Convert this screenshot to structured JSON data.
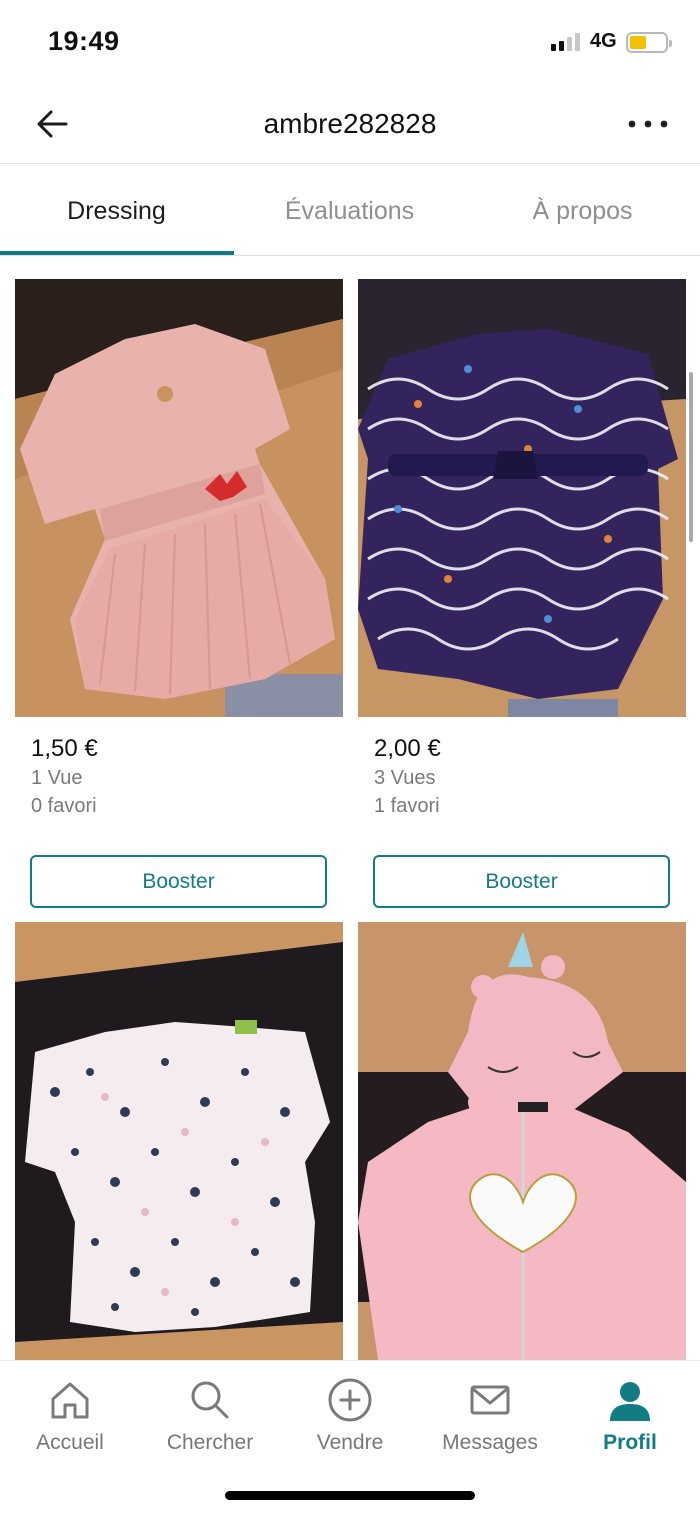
{
  "status_bar": {
    "time": "19:49",
    "network": "4G"
  },
  "header": {
    "title": "ambre282828"
  },
  "tabs": [
    {
      "label": "Dressing",
      "active": true
    },
    {
      "label": "Évaluations",
      "active": false
    },
    {
      "label": "À propos",
      "active": false
    }
  ],
  "items": [
    {
      "price": "1,50 €",
      "views": "1 Vue",
      "favorites": "0 favori",
      "button": "Booster"
    },
    {
      "price": "2,00 €",
      "views": "3 Vues",
      "favorites": "1 favori",
      "button": "Booster"
    }
  ],
  "bottom_nav": [
    {
      "label": "Accueil",
      "icon": "home-icon"
    },
    {
      "label": "Chercher",
      "icon": "search-icon"
    },
    {
      "label": "Vendre",
      "icon": "plus-circle-icon"
    },
    {
      "label": "Messages",
      "icon": "mail-icon"
    },
    {
      "label": "Profil",
      "icon": "profile-icon",
      "active": true
    }
  ],
  "colors": {
    "accent": "#127c84",
    "muted_text": "#7a7a7a",
    "battery": "#f2c200"
  }
}
